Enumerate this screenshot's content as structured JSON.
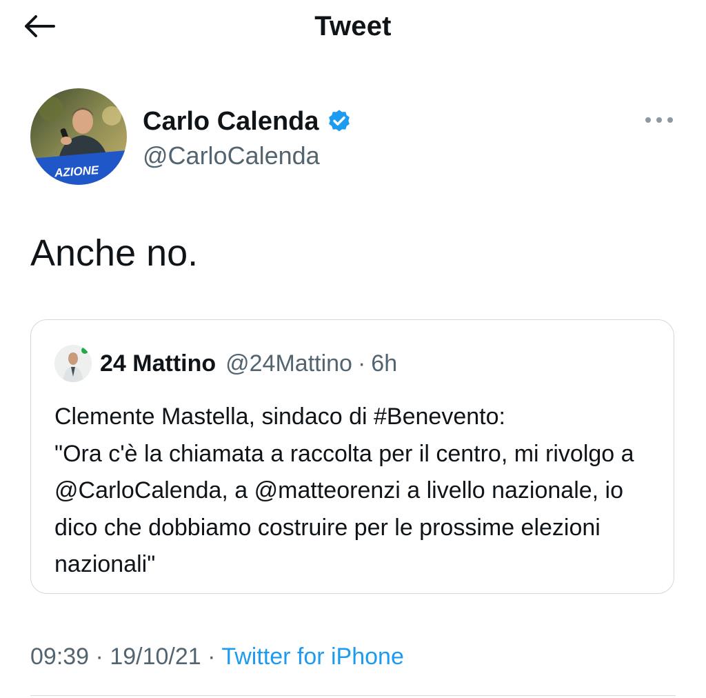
{
  "header": {
    "title": "Tweet",
    "back_icon": "arrow-left-icon"
  },
  "tweet": {
    "author_name": "Carlo Calenda",
    "author_handle": "@CarloCalenda",
    "avatar_badge": "AZIONE",
    "verified_icon": "verified-badge-icon",
    "more_icon": "more-horizontal-icon",
    "text": "Anche no.",
    "time": "09:39",
    "date": "19/10/21",
    "source": "Twitter for iPhone",
    "separator": "·"
  },
  "quoted_tweet": {
    "author_name": "24 Mattino",
    "author_handle": "@24Mattino",
    "separator": "·",
    "time_ago": "6h",
    "text": "Clemente Mastella, sindaco di #Benevento:\n\"Ora c'è la chiamata a raccolta per il centro, mi rivolgo a @CarloCalenda, a @matteorenzi a livello nazionale, io dico che dobbiamo costruire per le prossime elezioni nazionali\""
  },
  "colors": {
    "text": "#0f1419",
    "secondary": "#536471",
    "link": "#1d9bf0",
    "border": "#cfd9de",
    "verified": "#1d9bf0"
  }
}
